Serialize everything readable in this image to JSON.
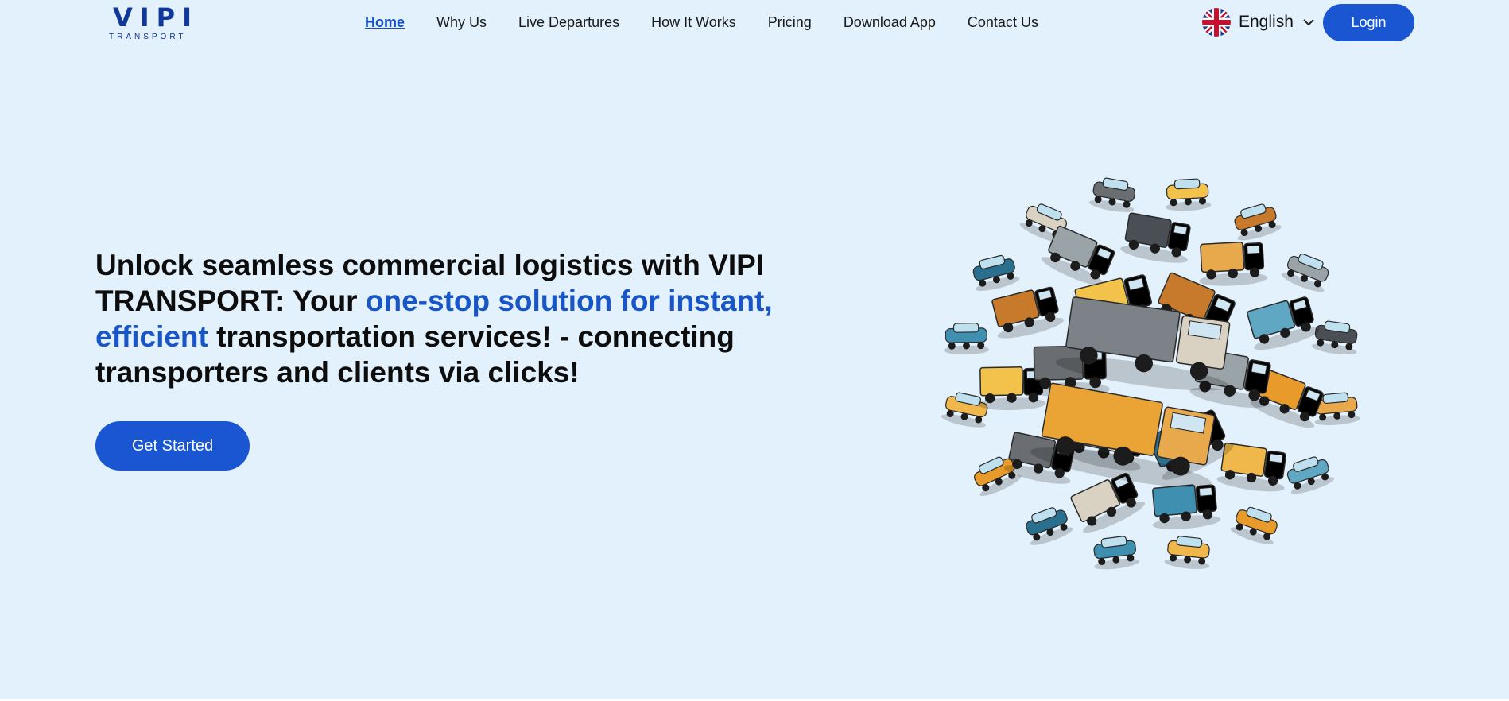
{
  "brand": {
    "name": "VIPI",
    "tagline": "TRANSPORT"
  },
  "nav": {
    "items": [
      {
        "label": "Home",
        "active": true
      },
      {
        "label": "Why Us"
      },
      {
        "label": "Live Departures"
      },
      {
        "label": "How It Works"
      },
      {
        "label": "Pricing"
      },
      {
        "label": "Download App"
      },
      {
        "label": "Contact Us"
      }
    ]
  },
  "language": {
    "label": "English",
    "flag_icon": "uk-flag-icon",
    "chevron_icon": "chevron-down-icon"
  },
  "login": {
    "label": "Login"
  },
  "hero": {
    "title_part1": "Unlock seamless commercial logistics with VIPI TRANSPORT: Your ",
    "title_highlight": "one-stop solution for instant, efficient",
    "title_part2": " transportation services! - connecting transporters and clients via clicks!",
    "cta_label": "Get Started",
    "illustration": "circular-cluster-of-trucks-and-vehicles"
  },
  "colors": {
    "background": "#e3f1fc",
    "accent": "#1a56d2",
    "highlight_text": "#1856c8",
    "logo": "#10379a"
  }
}
